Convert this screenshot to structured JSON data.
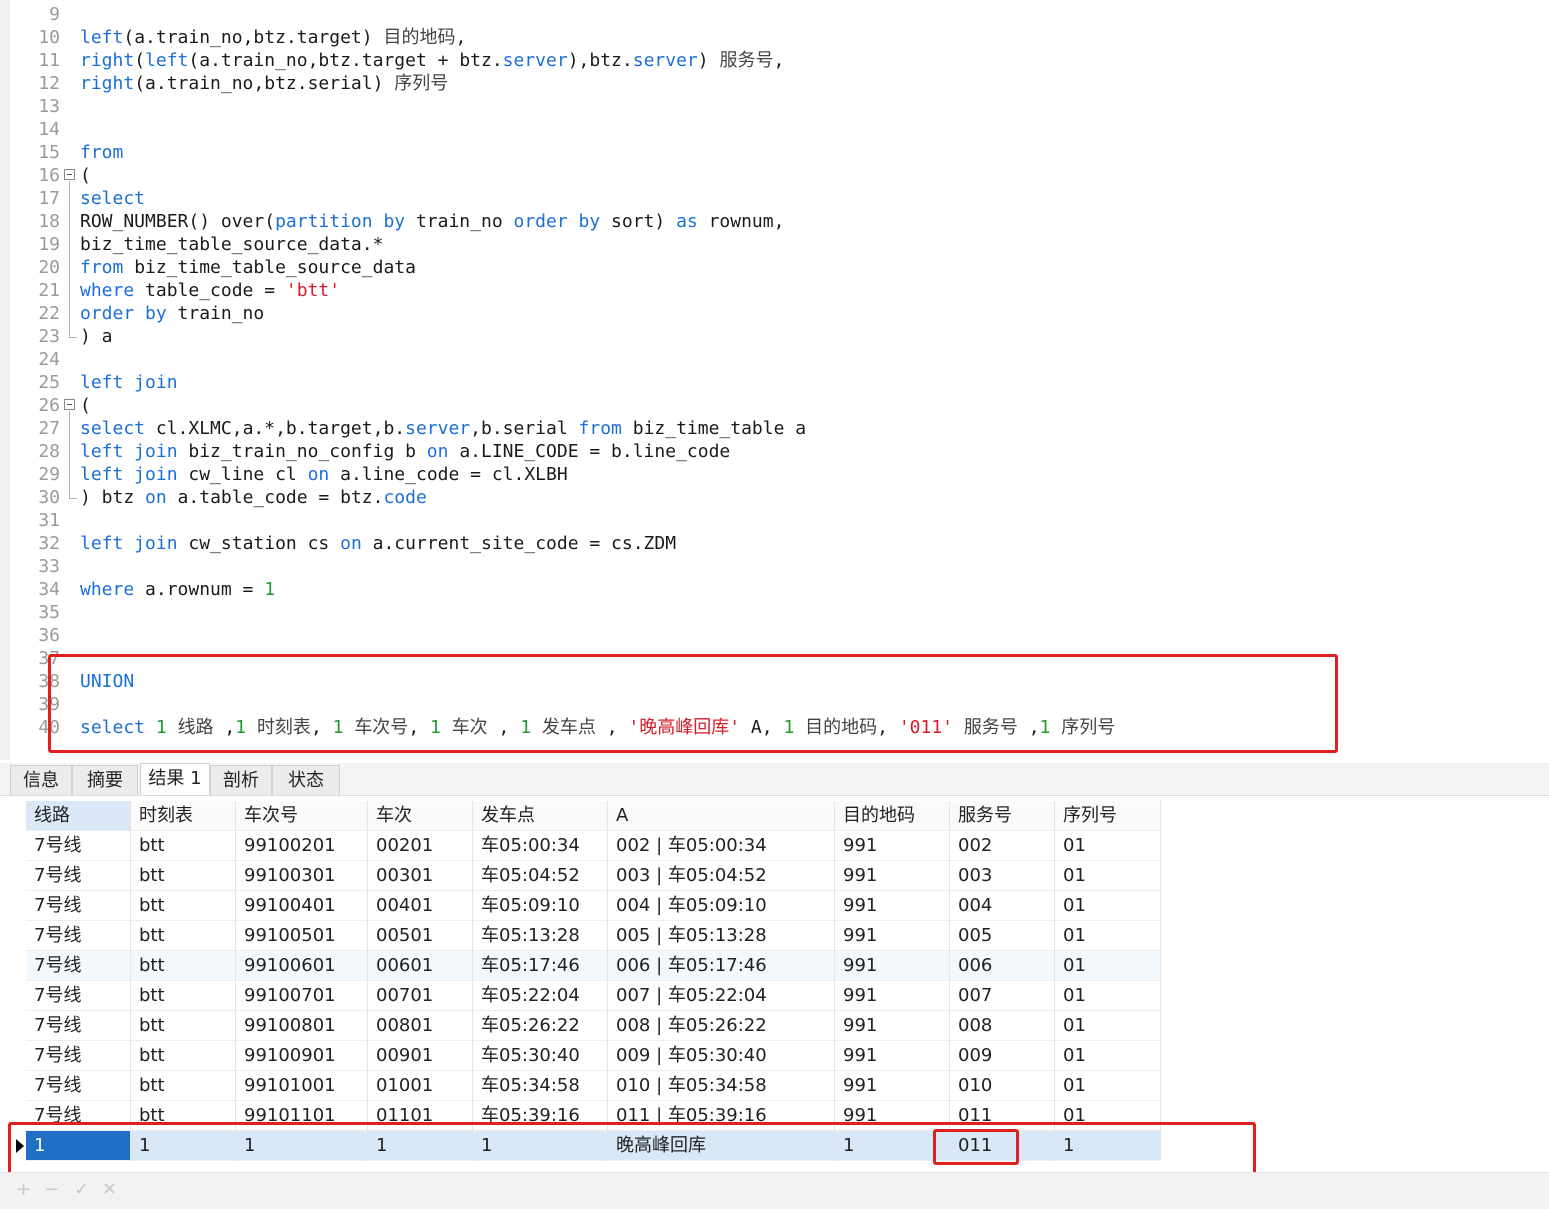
{
  "editor": {
    "lines": [
      {
        "n": "9",
        "t": []
      },
      {
        "n": "10",
        "t": [
          [
            "kw",
            "left"
          ],
          [
            "p",
            "(a.train_no,btz.target) "
          ],
          [
            "cjk",
            "目的地码"
          ],
          [
            "p",
            ","
          ]
        ]
      },
      {
        "n": "11",
        "t": [
          [
            "kw",
            "right"
          ],
          [
            "p",
            "("
          ],
          [
            "kw",
            "left"
          ],
          [
            "p",
            "(a.train_no,btz.target + btz."
          ],
          [
            "kw",
            "server"
          ],
          [
            "p",
            "),btz."
          ],
          [
            "kw",
            "server"
          ],
          [
            "p",
            ") "
          ],
          [
            "cjk",
            "服务号"
          ],
          [
            "p",
            ","
          ]
        ]
      },
      {
        "n": "12",
        "t": [
          [
            "kw",
            "right"
          ],
          [
            "p",
            "(a.train_no,btz.serial) "
          ],
          [
            "cjk",
            "序列号"
          ]
        ]
      },
      {
        "n": "13",
        "t": []
      },
      {
        "n": "14",
        "t": []
      },
      {
        "n": "15",
        "t": [
          [
            "kw",
            "from"
          ]
        ]
      },
      {
        "n": "16",
        "t": [
          [
            "p",
            "("
          ]
        ],
        "fold": "open"
      },
      {
        "n": "17",
        "t": [
          [
            "kw",
            "select"
          ]
        ]
      },
      {
        "n": "18",
        "t": [
          [
            "p",
            "ROW_NUMBER() over("
          ],
          [
            "kw",
            "partition by"
          ],
          [
            "p",
            " train_no "
          ],
          [
            "kw",
            "order by"
          ],
          [
            "p",
            " sort) "
          ],
          [
            "kw",
            "as"
          ],
          [
            "p",
            " rownum,"
          ]
        ]
      },
      {
        "n": "19",
        "t": [
          [
            "p",
            "biz_time_table_source_data.*"
          ]
        ]
      },
      {
        "n": "20",
        "t": [
          [
            "kw",
            "from"
          ],
          [
            "p",
            " biz_time_table_source_data"
          ]
        ]
      },
      {
        "n": "21",
        "t": [
          [
            "kw",
            "where"
          ],
          [
            "p",
            " table_code = "
          ],
          [
            "str",
            "'btt'"
          ]
        ]
      },
      {
        "n": "22",
        "t": [
          [
            "kw",
            "order by"
          ],
          [
            "p",
            " train_no"
          ]
        ]
      },
      {
        "n": "23",
        "t": [
          [
            "p",
            ") a"
          ]
        ],
        "fold": "end"
      },
      {
        "n": "24",
        "t": []
      },
      {
        "n": "25",
        "t": [
          [
            "kw",
            "left join"
          ]
        ]
      },
      {
        "n": "26",
        "t": [
          [
            "p",
            "("
          ]
        ],
        "fold": "open"
      },
      {
        "n": "27",
        "t": [
          [
            "kw",
            "select"
          ],
          [
            "p",
            " cl.XLMC,a.*,b.target,b."
          ],
          [
            "kw",
            "server"
          ],
          [
            "p",
            ",b.serial "
          ],
          [
            "kw",
            "from"
          ],
          [
            "p",
            " biz_time_table a"
          ]
        ]
      },
      {
        "n": "28",
        "t": [
          [
            "kw",
            "left join"
          ],
          [
            "p",
            " biz_train_no_config b "
          ],
          [
            "kw",
            "on"
          ],
          [
            "p",
            " a.LINE_CODE = b.line_code"
          ]
        ]
      },
      {
        "n": "29",
        "t": [
          [
            "kw",
            "left join"
          ],
          [
            "p",
            " cw_line cl "
          ],
          [
            "kw",
            "on"
          ],
          [
            "p",
            " a.line_code = cl.XLBH"
          ]
        ]
      },
      {
        "n": "30",
        "t": [
          [
            "p",
            ") btz "
          ],
          [
            "kw",
            "on"
          ],
          [
            "p",
            " a.table_code = btz."
          ],
          [
            "kw",
            "code"
          ]
        ],
        "fold": "end"
      },
      {
        "n": "31",
        "t": []
      },
      {
        "n": "32",
        "t": [
          [
            "kw",
            "left join"
          ],
          [
            "p",
            " cw_station cs "
          ],
          [
            "kw",
            "on"
          ],
          [
            "p",
            " a.current_site_code = cs.ZDM"
          ]
        ]
      },
      {
        "n": "33",
        "t": []
      },
      {
        "n": "34",
        "t": [
          [
            "kw",
            "where"
          ],
          [
            "p",
            " a.rownum = "
          ],
          [
            "num",
            "1"
          ]
        ]
      },
      {
        "n": "35",
        "t": []
      },
      {
        "n": "36",
        "t": []
      },
      {
        "n": "37",
        "t": []
      },
      {
        "n": "38",
        "t": [
          [
            "kw",
            "UNION"
          ]
        ]
      },
      {
        "n": "39",
        "t": []
      },
      {
        "n": "40",
        "t": [
          [
            "kw",
            "select"
          ],
          [
            "p",
            " "
          ],
          [
            "num",
            "1"
          ],
          [
            "p",
            " "
          ],
          [
            "cjk",
            "线路"
          ],
          [
            "p",
            " ,"
          ],
          [
            "num",
            "1"
          ],
          [
            "p",
            " "
          ],
          [
            "cjk",
            "时刻表"
          ],
          [
            "p",
            ", "
          ],
          [
            "num",
            "1"
          ],
          [
            "p",
            " "
          ],
          [
            "cjk",
            "车次号"
          ],
          [
            "p",
            ", "
          ],
          [
            "num",
            "1"
          ],
          [
            "p",
            " "
          ],
          [
            "cjk",
            "车次"
          ],
          [
            "p",
            " , "
          ],
          [
            "num",
            "1"
          ],
          [
            "p",
            " "
          ],
          [
            "cjk",
            "发车点"
          ],
          [
            "p",
            " , "
          ],
          [
            "str",
            "'晚高峰回库'"
          ],
          [
            "p",
            " A, "
          ],
          [
            "num",
            "1"
          ],
          [
            "p",
            " "
          ],
          [
            "cjk",
            "目的地码"
          ],
          [
            "p",
            ", "
          ],
          [
            "str",
            "'011'"
          ],
          [
            "p",
            " "
          ],
          [
            "cjk",
            "服务号"
          ],
          [
            "p",
            " ,"
          ],
          [
            "num",
            "1"
          ],
          [
            "p",
            " "
          ],
          [
            "cjk",
            "序列号"
          ]
        ]
      }
    ]
  },
  "tabs": [
    "信息",
    "摘要",
    "结果 1",
    "剖析",
    "状态"
  ],
  "active_tab": "结果 1",
  "result": {
    "columns": [
      "线路",
      "时刻表",
      "车次号",
      "车次",
      "发车点",
      "A",
      "目的地码",
      "服务号",
      "序列号"
    ],
    "rows": [
      [
        "7号线",
        "btt",
        "99100201",
        "00201",
        "车05:00:34",
        "002 | 车05:00:34",
        "991",
        "002",
        "01"
      ],
      [
        "7号线",
        "btt",
        "99100301",
        "00301",
        "车05:04:52",
        "003 | 车05:04:52",
        "991",
        "003",
        "01"
      ],
      [
        "7号线",
        "btt",
        "99100401",
        "00401",
        "车05:09:10",
        "004 | 车05:09:10",
        "991",
        "004",
        "01"
      ],
      [
        "7号线",
        "btt",
        "99100501",
        "00501",
        "车05:13:28",
        "005 | 车05:13:28",
        "991",
        "005",
        "01"
      ],
      [
        "7号线",
        "btt",
        "99100601",
        "00601",
        "车05:17:46",
        "006 | 车05:17:46",
        "991",
        "006",
        "01"
      ],
      [
        "7号线",
        "btt",
        "99100701",
        "00701",
        "车05:22:04",
        "007 | 车05:22:04",
        "991",
        "007",
        "01"
      ],
      [
        "7号线",
        "btt",
        "99100801",
        "00801",
        "车05:26:22",
        "008 | 车05:26:22",
        "991",
        "008",
        "01"
      ],
      [
        "7号线",
        "btt",
        "99100901",
        "00901",
        "车05:30:40",
        "009 | 车05:30:40",
        "991",
        "009",
        "01"
      ],
      [
        "7号线",
        "btt",
        "99101001",
        "01001",
        "车05:34:58",
        "010 | 车05:34:58",
        "991",
        "010",
        "01"
      ],
      [
        "7号线",
        "btt",
        "99101101",
        "01101",
        "车05:39:16",
        "011 | 车05:39:16",
        "991",
        "011",
        "01"
      ]
    ],
    "union_row": [
      "1",
      "1",
      "1",
      "1",
      "1",
      "晚高峰回库",
      "1",
      "011",
      "1"
    ]
  },
  "statusbar": {
    "icons": [
      "add-icon",
      "remove-icon",
      "apply-icon",
      "cancel-icon"
    ],
    "glyphs": [
      "+",
      "−",
      "✓",
      "✕"
    ]
  },
  "colors": {
    "keyword": "#1c6fd6",
    "number": "#1f9a32",
    "string": "#d81b2a",
    "highlight": "#e02020",
    "selection": "#1f6fc4"
  }
}
